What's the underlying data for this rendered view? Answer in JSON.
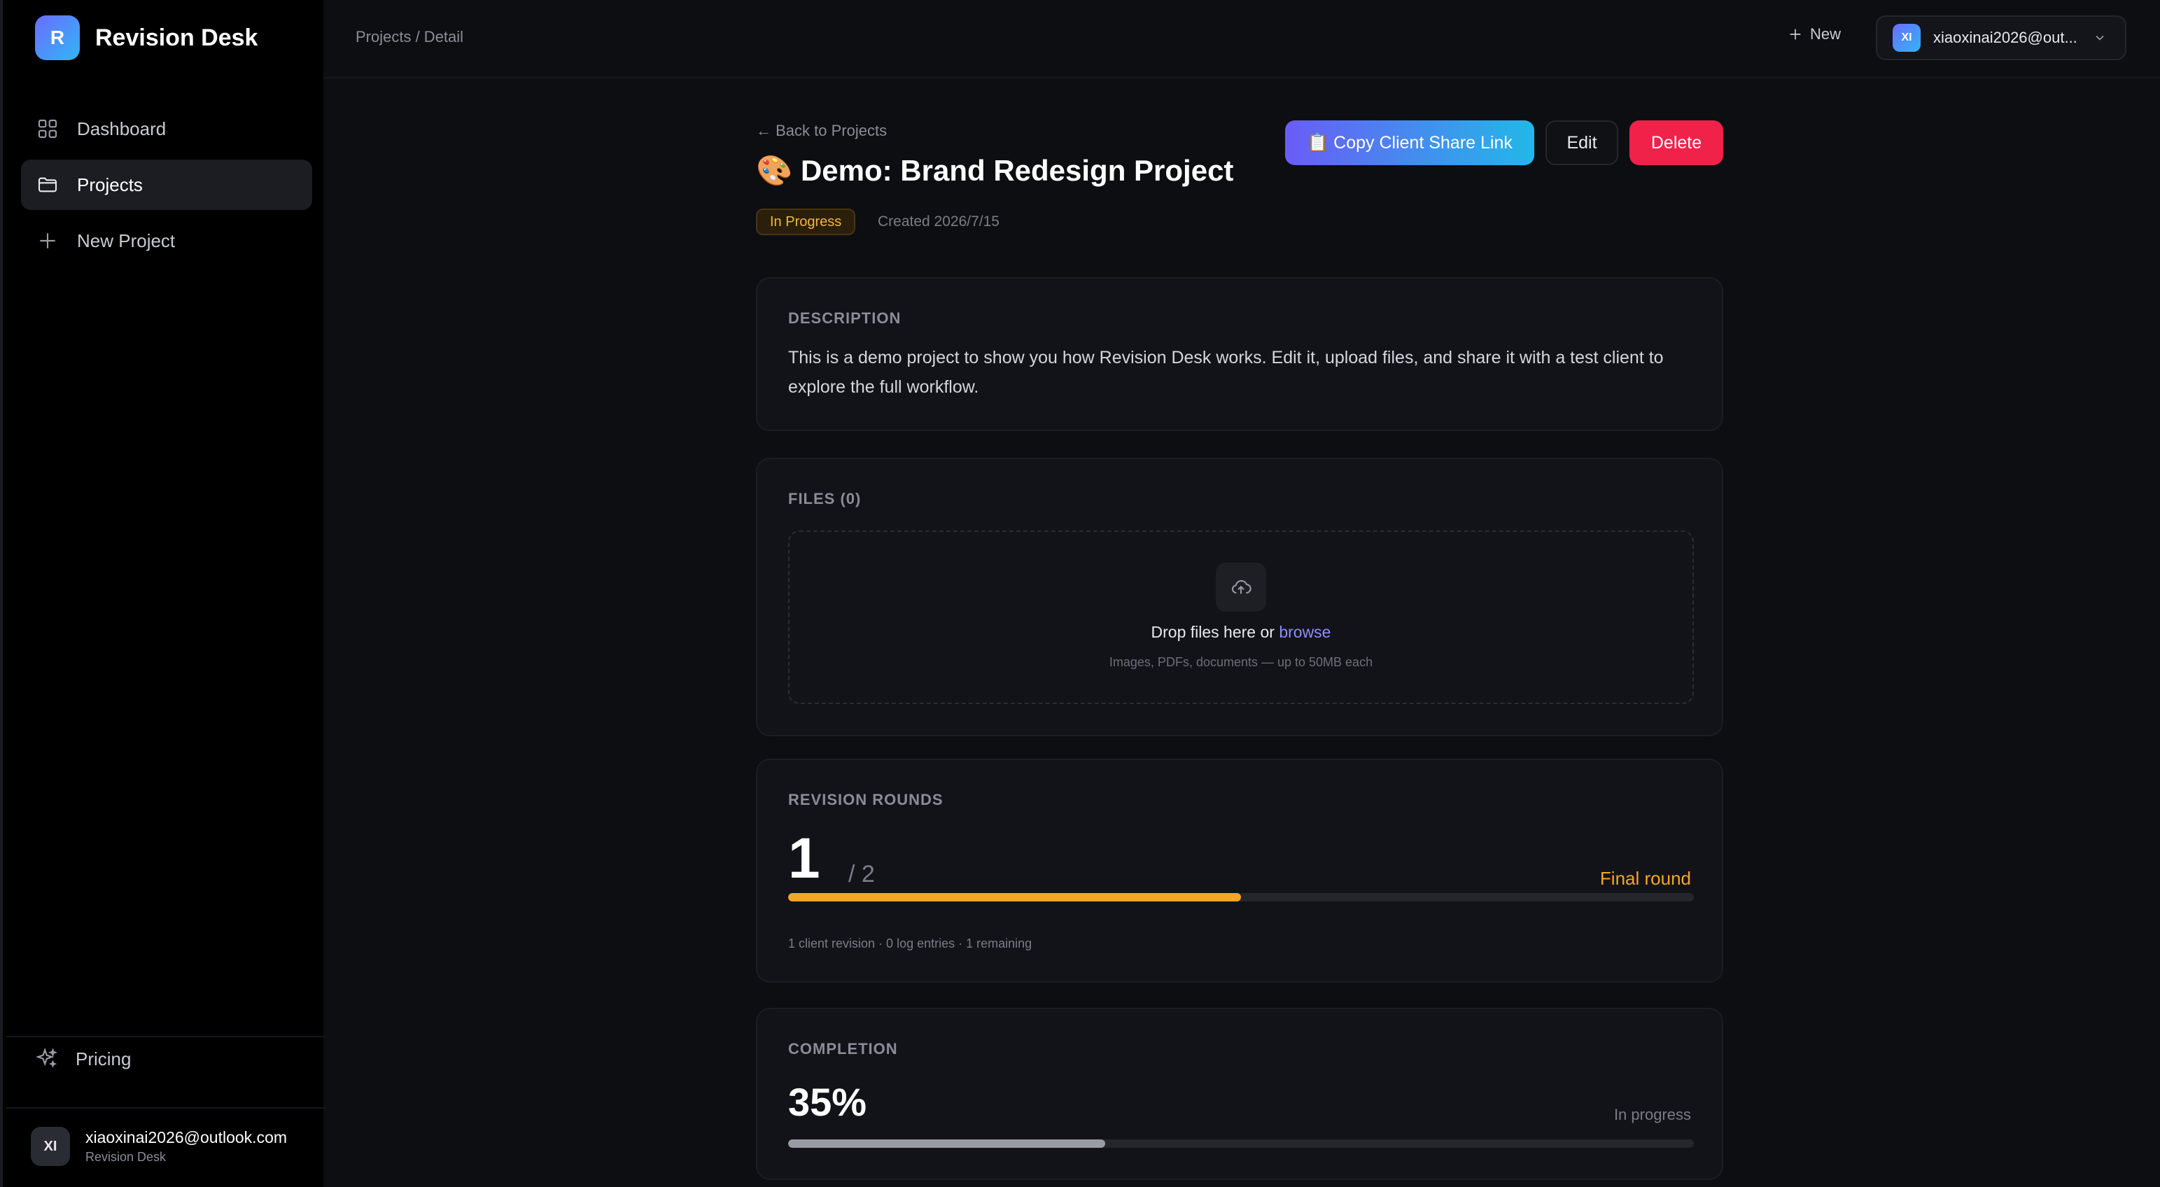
{
  "sidebar": {
    "brand": {
      "initial": "R",
      "name": "Revision Desk"
    },
    "nav": [
      {
        "label": "Dashboard",
        "icon": "grid-icon",
        "active": false
      },
      {
        "label": "Projects",
        "icon": "folder-icon",
        "active": true
      },
      {
        "label": "New Project",
        "icon": "plus-icon",
        "active": false
      }
    ],
    "pricing": {
      "label": "Pricing",
      "icon": "sparkles-icon"
    },
    "user": {
      "initials": "XI",
      "email": "xiaoxinai2026@outlook.com",
      "sub": "Revision Desk"
    }
  },
  "topbar": {
    "breadcrumb": "Projects / Detail",
    "new_label": "New",
    "account": {
      "initials": "XI",
      "email": "xiaoxinai2026@out..."
    }
  },
  "project": {
    "back_label": "← Back to Projects",
    "title": "🎨 Demo: Brand Redesign Project",
    "status": "In Progress",
    "created": "Created 2026/7/15",
    "actions": {
      "share": "📋 Copy Client Share Link",
      "edit": "Edit",
      "delete": "Delete"
    },
    "description": {
      "label": "DESCRIPTION",
      "text": "This is a demo project to show you how Revision Desk works. Edit it, upload files, and share it with a test client to explore the full workflow."
    },
    "files": {
      "label": "FILES (0)",
      "drop_text": "Drop files here or ",
      "browse": "browse",
      "hint": "Images, PDFs, documents — up to 50MB each"
    },
    "revisions": {
      "label": "REVISION ROUNDS",
      "current": "1",
      "total": "/ 2",
      "badge": "Final round",
      "progress": 0.5,
      "meta": "1 client revision · 0 log entries · 1 remaining"
    },
    "completion": {
      "label": "COMPLETION",
      "percent": "35%",
      "progress": 0.35,
      "status": "In progress"
    }
  },
  "colors": {
    "accent_warning": "#f5a623",
    "danger": "#f0224a",
    "link": "#8f8cff"
  }
}
